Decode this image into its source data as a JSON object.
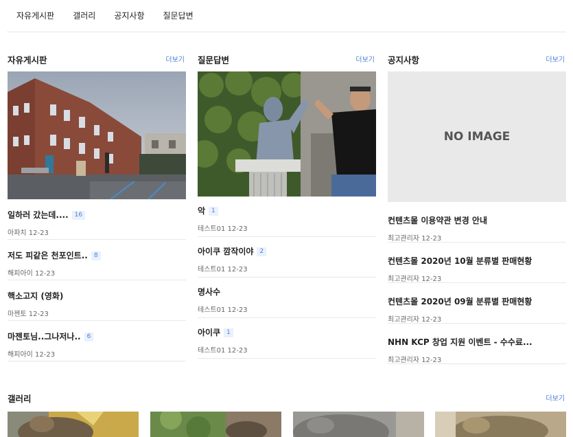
{
  "nav": {
    "items": [
      "자유게시판",
      "갤러리",
      "공지사항",
      "질문답변"
    ]
  },
  "boards": {
    "free": {
      "title": "자유게시판",
      "more": "더보기",
      "posts": [
        {
          "title": "일하러 갔는데....",
          "count": "16",
          "author": "아파치",
          "date": "12-23"
        },
        {
          "title": "저도 피같은 천포인트..",
          "count": "8",
          "author": "해피아이",
          "date": "12-23"
        },
        {
          "title": "핵소고지 (영화)",
          "count": "",
          "author": "마젠토",
          "date": "12-23"
        },
        {
          "title": "마젠토님..그나저나..",
          "count": "6",
          "author": "해피아이",
          "date": "12-23"
        }
      ]
    },
    "qna": {
      "title": "질문답변",
      "more": "더보기",
      "posts": [
        {
          "title": "악",
          "count": "1",
          "author": "테스트01",
          "date": "12-23"
        },
        {
          "title": "아이쿠 깜작이야",
          "count": "2",
          "author": "테스트01",
          "date": "12-23"
        },
        {
          "title": "명사수",
          "count": "",
          "author": "테스트01",
          "date": "12-23"
        },
        {
          "title": "아이쿠",
          "count": "1",
          "author": "테스트01",
          "date": "12-23"
        }
      ]
    },
    "notice": {
      "title": "공지사항",
      "more": "더보기",
      "no_image": "NO IMAGE",
      "posts": [
        {
          "title": "컨텐츠몰 이용약관 변경 안내",
          "author": "최고관리자",
          "date": "12-23"
        },
        {
          "title": "컨텐츠몰 2020년 10월 분류별 판매현황",
          "author": "최고관리자",
          "date": "12-23"
        },
        {
          "title": "컨텐츠몰 2020년 09월 분류별 판매현황",
          "author": "최고관리자",
          "date": "12-23"
        },
        {
          "title": "NHN KCP 창업 지원 이벤트 - 수수료...",
          "author": "최고관리자",
          "date": "12-23"
        }
      ]
    }
  },
  "gallery": {
    "title": "갤러리",
    "more": "더보기"
  },
  "colors": {
    "accent": "#4a7fd4",
    "badge_bg": "#eaf1fd",
    "divider": "#e8e8e8"
  }
}
